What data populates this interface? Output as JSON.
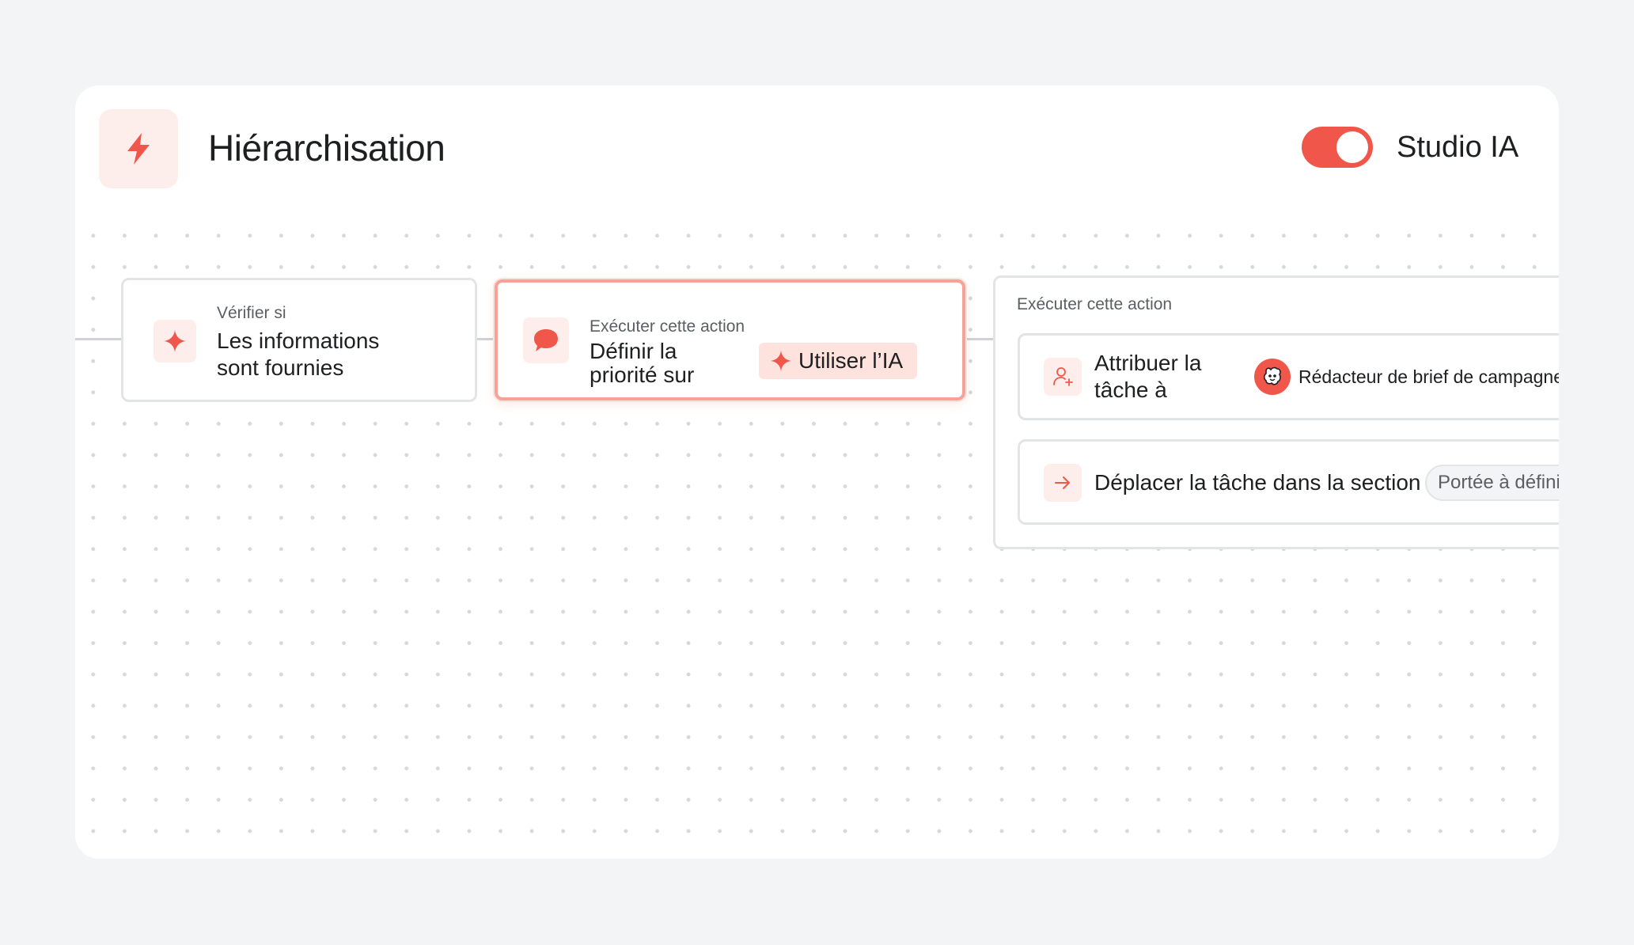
{
  "header": {
    "title": "Hiérarchisation",
    "icon": "lightning-bolt-icon",
    "toggle_label": "Studio IA",
    "toggle_on": true
  },
  "colors": {
    "accent": "#f0574a",
    "accent_soft": "#fdeeec",
    "border": "#e3e4e6",
    "background": "#f3f4f6"
  },
  "nodes": {
    "condition": {
      "label": "Vérifier si",
      "text_line1": "Les informations",
      "text_line2": "sont fournies",
      "icon": "sparkle-icon"
    },
    "action_priority": {
      "label": "Exécuter cette action",
      "text_line1": "Définir la",
      "text_line2": "priorité sur",
      "icon": "chat-bubble-icon",
      "ai_button": "Utiliser l’IA"
    },
    "action_group": {
      "label": "Exécuter cette action",
      "assign": {
        "text_line1": "Attribuer la",
        "text_line2": "tâche à",
        "icon": "user-add-icon",
        "agent_name": "Rédacteur de brief de campagne"
      },
      "move": {
        "text": "Déplacer la tâche dans la section",
        "icon": "arrow-right-icon",
        "section": "Portée à définir"
      }
    }
  }
}
